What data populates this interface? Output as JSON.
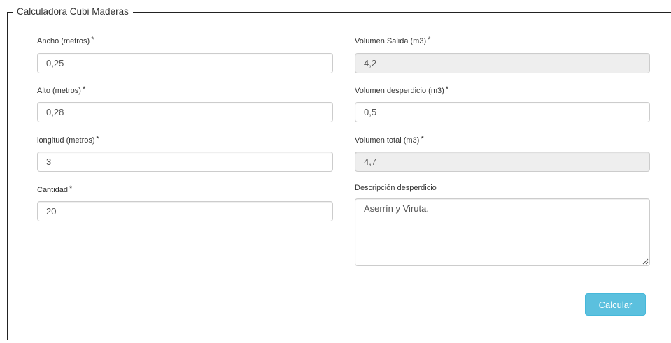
{
  "form": {
    "legend": "Calculadora Cubi Maderas",
    "required_marker": "*",
    "left_fields": [
      {
        "label": "Ancho (metros)",
        "value": "0,25",
        "required": true
      },
      {
        "label": "Alto (metros)",
        "value": "0,28",
        "required": true
      },
      {
        "label": "longitud (metros)",
        "value": "3",
        "required": true
      },
      {
        "label": "Cantidad",
        "value": "20",
        "required": true
      }
    ],
    "right_fields": [
      {
        "label": "Volumen Salida (m3)",
        "value": "4,2",
        "required": true,
        "readonly": true
      },
      {
        "label": "Volumen desperdicio (m3)",
        "value": "0,5",
        "required": true,
        "readonly": false
      },
      {
        "label": "Volumen total (m3)",
        "value": "4,7",
        "required": true,
        "readonly": true
      }
    ],
    "description": {
      "label": "Descripción desperdicio",
      "value": "Aserrín y Viruta."
    },
    "submit_label": "Calcular",
    "colors": {
      "button_bg": "#5bc0de",
      "readonly_bg": "#eeeeee",
      "input_border": "#cccccc"
    }
  }
}
